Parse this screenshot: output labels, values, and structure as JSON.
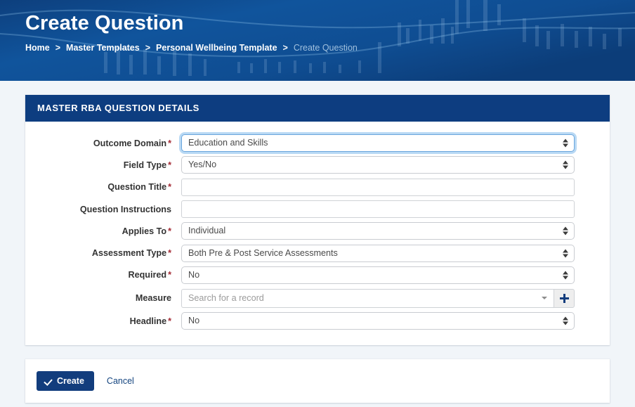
{
  "banner": {
    "title": "Create Question",
    "breadcrumb": [
      {
        "label": "Home",
        "current": false
      },
      {
        "label": "Master Templates",
        "current": false
      },
      {
        "label": "Personal Wellbeing Template",
        "current": false
      },
      {
        "label": "Create Question",
        "current": true
      }
    ],
    "separator": ">",
    "bg_color": "#114a8c"
  },
  "panel": {
    "header": "MASTER RBA QUESTION DETAILS",
    "header_bg": "#0d3d80",
    "fields": {
      "outcome_domain": {
        "label": "Outcome Domain",
        "required": true,
        "value": "Education and Skills",
        "type": "select",
        "focused": true
      },
      "field_type": {
        "label": "Field Type",
        "required": true,
        "value": "Yes/No",
        "type": "select",
        "focused": false
      },
      "question_title": {
        "label": "Question Title",
        "required": true,
        "value": "",
        "placeholder": "",
        "type": "text"
      },
      "question_instructions": {
        "label": "Question Instructions",
        "required": false,
        "value": "",
        "placeholder": "",
        "type": "text"
      },
      "applies_to": {
        "label": "Applies To",
        "required": true,
        "value": "Individual",
        "type": "select",
        "focused": false
      },
      "assessment_type": {
        "label": "Assessment Type",
        "required": true,
        "value": "Both Pre & Post Service Assessments",
        "type": "select",
        "focused": false
      },
      "required_field": {
        "label": "Required",
        "required": true,
        "value": "No",
        "type": "select",
        "focused": false
      },
      "measure": {
        "label": "Measure",
        "required": false,
        "value": "",
        "placeholder": "Search for a record",
        "type": "lookup",
        "add_icon": "plus-icon"
      },
      "headline": {
        "label": "Headline",
        "required": true,
        "value": "No",
        "type": "select",
        "focused": false
      }
    }
  },
  "actions": {
    "create_label": "Create",
    "create_icon": "check-icon",
    "create_color": "#123d7d",
    "cancel_label": "Cancel",
    "cancel_color": "#13447f"
  },
  "required_marker": "*"
}
